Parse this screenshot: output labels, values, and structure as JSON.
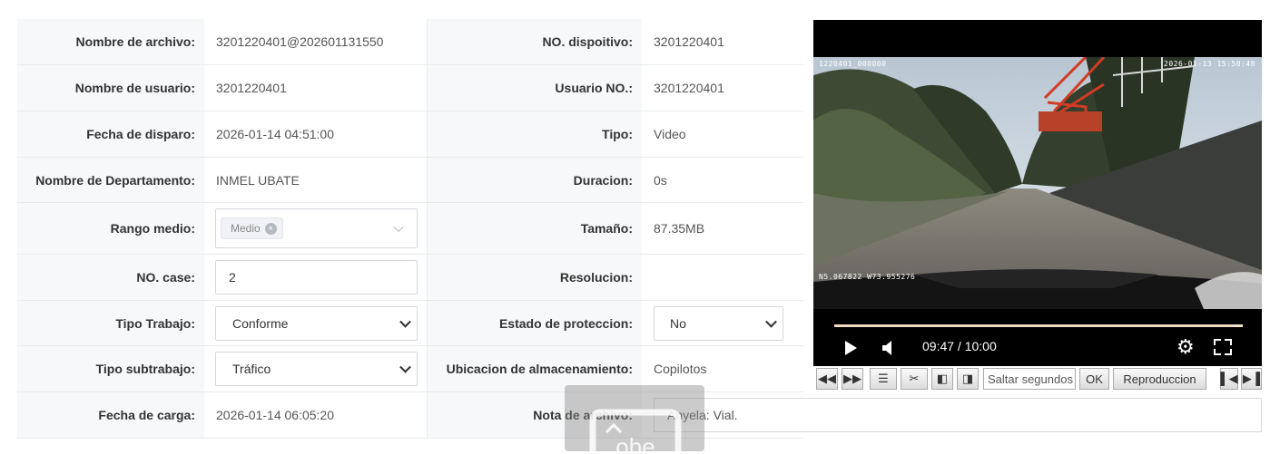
{
  "form": {
    "rows": [
      {
        "label1": "Nombre de archivo:",
        "value1": "3201220401@202601131550",
        "label2": "NO. dispoitivo:",
        "value2": "3201220401"
      },
      {
        "label1": "Nombre de usuario:",
        "value1": "3201220401",
        "label2": "Usuario NO.:",
        "value2": "3201220401"
      },
      {
        "label1": "Fecha de disparo:",
        "value1": "2026-01-14 04:51:00",
        "label2": "Tipo:",
        "value2": "Video"
      },
      {
        "label1": "Nombre de Departamento:",
        "value1": "INMEL UBATE",
        "label2": "Duracion:",
        "value2": "0s"
      },
      {
        "label1": "Rango medio:",
        "value1": "",
        "label2": "Tamaño:",
        "value2": "87.35MB"
      },
      {
        "label1": "NO. case:",
        "value1": "",
        "label2": "Resolucion:",
        "value2": ""
      },
      {
        "label1": "Tipo Trabajo:",
        "value1": "",
        "label2": "Estado de proteccion:",
        "value2": ""
      },
      {
        "label1": "Tipo subtrabajo:",
        "value1": "",
        "label2": "Ubicacion de almacenamiento:",
        "value2": "Copilotos"
      },
      {
        "label1": "Fecha de carga:",
        "value1": "2026-01-14 06:05:20",
        "label2": "Nota de archivo:",
        "value2": ""
      }
    ],
    "rango_tag": "Medio",
    "case_value": "2",
    "tipo_trabajo": "Conforme",
    "tipo_subtrabajo": "Tráfico",
    "estado_proteccion": "No",
    "nota": "Anyela: Vial."
  },
  "player": {
    "osd_device": "1220401_000000",
    "osd_datetime": "2026-01-13  15:50:48",
    "osd_gps": "N5.067822  W73.955276",
    "time": "09:47 / 10:00",
    "progress": 0.978,
    "icons": [
      "play-icon",
      "volume-icon",
      "settings-icon",
      "fullscreen-icon"
    ]
  },
  "toolbar": {
    "icons": [
      "rewind-icon",
      "fast-forward-icon",
      "list-icon",
      "scissors-icon",
      "prev-frame-icon",
      "next-frame-icon"
    ],
    "seek_placeholder": "Saltar segundos",
    "ok_label": "OK",
    "playback_label": "Reproduccion",
    "end_icons": [
      "skip-start-icon",
      "skip-end-icon"
    ]
  },
  "overlay_text": "obe",
  "colors": {
    "label_bg": "#f7f8fa",
    "border": "#e9ebef",
    "player_bg": "#000000"
  }
}
